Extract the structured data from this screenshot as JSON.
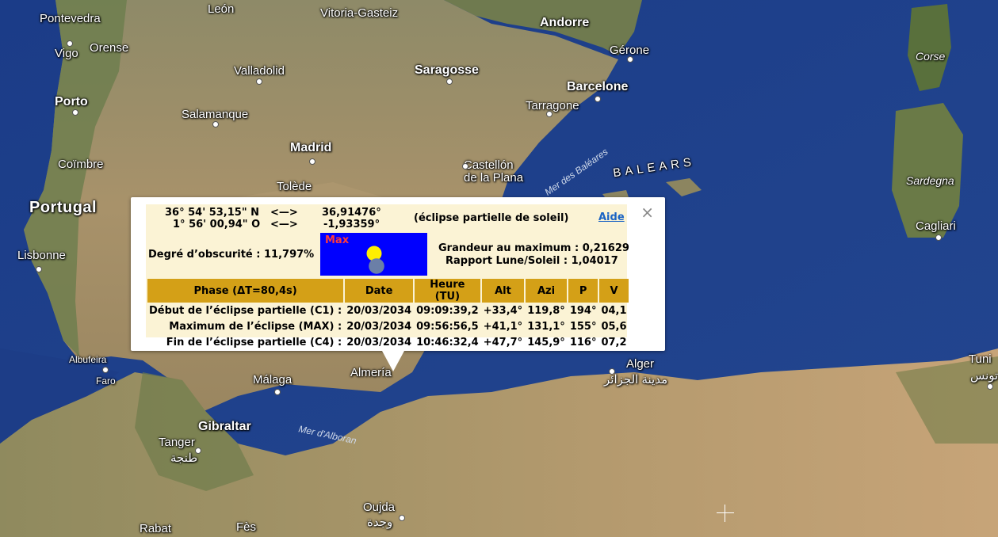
{
  "map": {
    "labels": {
      "pontevedra": "Pontevedra",
      "leon": "León",
      "vitoria": "Vitoria-Gasteiz",
      "andorre": "Andorre",
      "vigo": "Vigo",
      "orense": "Orense",
      "gerone": "Gérone",
      "corse": "Corse",
      "valladolid": "Valladolid",
      "saragosse": "Saragosse",
      "barcelone": "Barcelone",
      "porto": "Porto",
      "tarragone": "Tarragone",
      "salamanque": "Salamanque",
      "madrid": "Madrid",
      "coimbre": "Coïmbre",
      "castellon": "Castellón\nde la Plana",
      "baleares": "BALEARS",
      "mer_baleares": "Mer des Baléares",
      "sardegna": "Sardegna",
      "tolede": "Tolède",
      "portugal": "Portugal",
      "lisbonne": "Lisbonne",
      "cagliari": "Cagliari",
      "albufeira": "Albufeira",
      "faro": "Faro",
      "malaga": "Málaga",
      "almeria": "Almería",
      "alger": "Alger",
      "alger_ar": "مدينة الجزائر",
      "tunis": "Tuni",
      "tunis_ar": "تونس",
      "gibraltar": "Gibraltar",
      "mer_alboran": "Mer d'Alboran",
      "tanger": "Tanger",
      "tanger_ar": "طنجة",
      "oujda": "Oujda",
      "oujda_ar": "وجدة",
      "rabat": "Rabat",
      "fes": "Fès"
    }
  },
  "popup": {
    "lat_dms": "36° 54' 53,15\" N",
    "lon_dms": "1° 56' 00,94\" O",
    "arrow": "<—>",
    "lat_dec": "36,91476°",
    "lon_dec": "-1,93359°",
    "eclipse_type": "(éclipse partielle de soleil)",
    "help_link": "Aide",
    "close": "×",
    "obscuration": "Degré d’obscurité : 11,797%",
    "max_label": "Max",
    "magnitude": "Grandeur au maximum : 0,21629",
    "ratio": "Rapport Lune/Soleil : 1,04017",
    "table": {
      "headers": [
        "Phase (ΔT=80,4s)",
        "Date",
        "Heure (TU)",
        "Alt",
        "Azi",
        "P",
        "V"
      ],
      "rows": [
        [
          "Début de l’éclipse partielle (C1) :",
          "20/03/2034",
          "09:09:39,2",
          "+33,4°",
          "119,8°",
          "194°",
          "04,1"
        ],
        [
          "Maximum de l’éclipse (MAX) :",
          "20/03/2034",
          "09:56:56,5",
          "+41,1°",
          "131,1°",
          "155°",
          "05,6"
        ],
        [
          "Fin de l’éclipse partielle (C4) :",
          "20/03/2034",
          "10:46:32,4",
          "+47,7°",
          "145,9°",
          "116°",
          "07,2"
        ]
      ]
    }
  },
  "colors": {
    "sea": "#1f3f8a",
    "land": "#9c8a5e",
    "popup_bg": "#fbf3d5",
    "header_bg": "#d4a017",
    "eclipse_bg": "#0000ff",
    "link": "#1a63c4"
  }
}
